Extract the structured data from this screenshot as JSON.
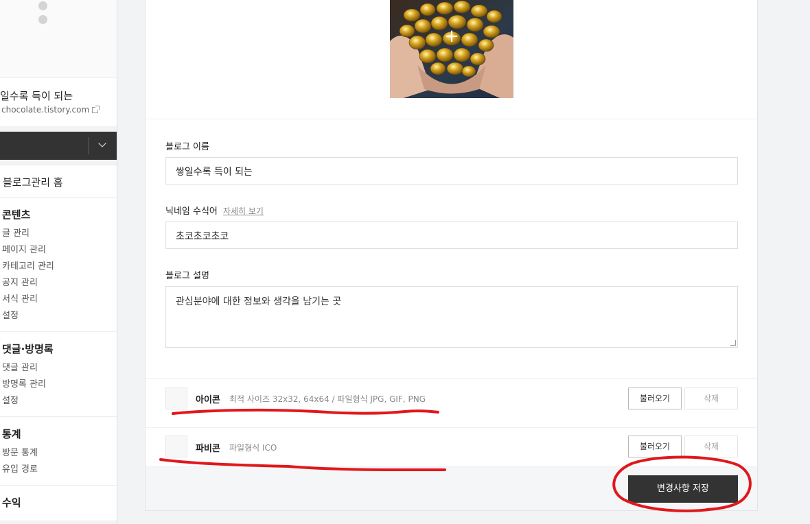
{
  "sidebar": {
    "blog_title": "일수록 득이 되는",
    "blog_url": "chocolate.tistory.com",
    "home": "블로그관리 홈",
    "sections": [
      {
        "title": "콘텐츠",
        "items": [
          "글 관리",
          "페이지 관리",
          "카테고리 관리",
          "공지 관리",
          "서식 관리",
          "설정"
        ]
      },
      {
        "title": "댓글·방명록",
        "items": [
          "댓글 관리",
          "방명록 관리",
          "설정"
        ]
      },
      {
        "title": "통계",
        "items": [
          "방문 통계",
          "유입 경로"
        ]
      },
      {
        "title": "수익",
        "items": []
      }
    ]
  },
  "form": {
    "image_plus": "+",
    "blog_name_label": "블로그 이름",
    "blog_name_value": "쌓일수록 득이 되는",
    "nickname_label": "닉네임 수식어",
    "nickname_detail_link": "자세히 보기",
    "nickname_value": "초코초코초코",
    "description_label": "블로그 설명",
    "description_value": "관심분야에 대한 정보와 생각을 남기는 곳"
  },
  "icon_row": {
    "title": "아이콘",
    "desc": "최적 사이즈 32x32, 64x64 / 파일형식 JPG, GIF, PNG",
    "load_label": "불러오기",
    "delete_label": "삭제"
  },
  "favicon_row": {
    "title": "파비콘",
    "desc": "파일형식 ICO",
    "load_label": "불러오기",
    "delete_label": "삭제"
  },
  "footer": {
    "save_label": "변경사항 저장"
  },
  "colors": {
    "annotation": "#e0181c",
    "save_button": "#333333"
  }
}
